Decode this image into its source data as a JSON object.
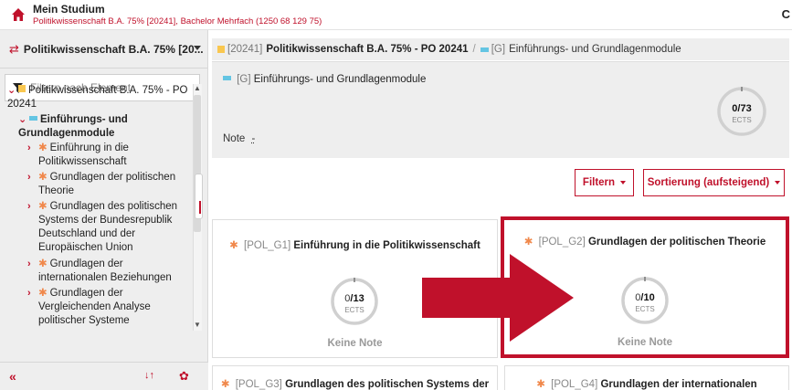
{
  "header": {
    "title": "Mein Studium",
    "subtitle": "Politikwissenschaft B.A. 75% [20241], Bachelor Mehrfach (1250 68 129 75)",
    "right_glyph": "C"
  },
  "sidebar": {
    "program_switch_label": "Politikwissenschaft B.A. 75% [20...",
    "filter_placeholder": "Filtern nach Element",
    "tree": [
      {
        "line1": "Politikwissenschaft B.A. 75% - PO",
        "line2": "20241"
      },
      {
        "line1": "Einführungs- und",
        "line2": "Grundlagenmodule"
      },
      {
        "line1": "Einführung in die",
        "line2": "Politikwissenschaft"
      },
      {
        "line1": "Grundlagen der politischen",
        "line2": "Theorie"
      },
      {
        "line1": "Grundlagen des politischen",
        "line2": "Systems der Bundesrepublik",
        "line3": "Deutschland und der",
        "line4": "Europäischen Union"
      },
      {
        "line1": "Grundlagen der",
        "line2": "internationalen Beziehungen"
      },
      {
        "line1": "Grundlagen der",
        "line2": "Vergleichenden Analyse",
        "line3": "politischer Systeme"
      }
    ],
    "collapse_glyph": "«",
    "sort_glyph": "↓↑",
    "settings_glyph": "✿"
  },
  "breadcrumb": {
    "item1_code": "[20241]",
    "item1_label": "Politikwissenschaft B.A. 75% - PO 20241",
    "separator": "/",
    "item2_code": "[G]",
    "item2_label": "Einführungs- und Grundlagenmodule"
  },
  "group": {
    "code": "[G]",
    "title": "Einführungs- und Grundlagenmodule",
    "note_label": "Note",
    "note_value": "-",
    "ects_earned": "0",
    "ects_total": "/73",
    "ects_unit": "ECTS"
  },
  "toolbar": {
    "filter_label": "Filtern",
    "sort_label": "Sortierung (aufsteigend)"
  },
  "modules": [
    {
      "code": "[POL_G1]",
      "title": "Einführung in die Politikwissenschaft",
      "ects_earned": "0",
      "ects_total": "/13",
      "ects_unit": "ECTS",
      "grade": "Keine Note"
    },
    {
      "code": "[POL_G2]",
      "title": "Grundlagen der politischen Theorie",
      "ects_earned": "0",
      "ects_total": "/10",
      "ects_unit": "ECTS",
      "grade": "Keine Note"
    },
    {
      "code": "[POL_G3]",
      "title": "Grundlagen des politischen Systems der"
    },
    {
      "code": "[POL_G4]",
      "title": "Grundlagen der internationalen"
    }
  ],
  "colors": {
    "accent": "#c0112b",
    "module_marker": "#f0884b",
    "program_marker": "#f9c74f",
    "group_marker": "#64c5e3",
    "panel_bg": "#eeeeee"
  },
  "icons": {
    "home": "home-icon",
    "swap": "swap-icon",
    "filter": "funnel-icon",
    "chevron": "chevron-icon",
    "arrow": "annotation-arrow"
  }
}
